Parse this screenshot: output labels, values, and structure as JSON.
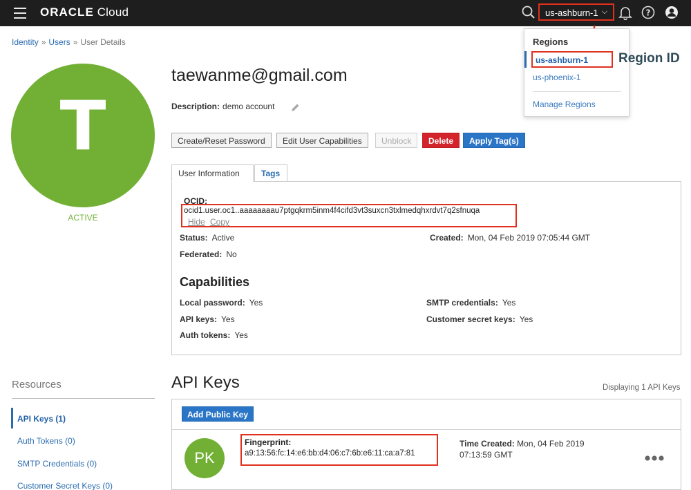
{
  "header": {
    "logo_brand": "ORACLE",
    "logo_product": " Cloud",
    "region_selected": "us-ashburn-1"
  },
  "region_menu": {
    "title": "Regions",
    "items": [
      "us-ashburn-1",
      "us-phoenix-1"
    ],
    "manage": "Manage Regions",
    "callout": "Region ID"
  },
  "breadcrumb": {
    "items": [
      "Identity",
      "Users",
      "User Details"
    ],
    "separator": "»"
  },
  "user": {
    "initial": "T",
    "state": "ACTIVE",
    "email": "taewanme@gmail.com",
    "description_label": "Description:",
    "description": "demo account"
  },
  "actions": {
    "create_reset_password": "Create/Reset Password",
    "edit_capabilities": "Edit User Capabilities",
    "unblock": "Unblock",
    "delete": "Delete",
    "apply_tags": "Apply Tag(s)"
  },
  "tabs": {
    "user_information": "User Information",
    "tags": "Tags"
  },
  "info": {
    "ocid_label": "OCID:",
    "ocid_value": "ocid1.user.oc1..aaaaaaaau7ptgqkrm5inm4f4cifd3vt3suxcn3txlmedqhxrdvt7q2sfnuqa",
    "hide": "Hide",
    "copy": "Copy",
    "status_label": "Status:",
    "status_value": "Active",
    "created_label": "Created:",
    "created_value": "Mon, 04 Feb 2019 07:05:44 GMT",
    "federated_label": "Federated:",
    "federated_value": "No"
  },
  "capabilities": {
    "title": "Capabilities",
    "local_password_label": "Local password:",
    "local_password": "Yes",
    "smtp_label": "SMTP credentials:",
    "smtp": "Yes",
    "api_keys_label": "API keys:",
    "api_keys": "Yes",
    "customer_secret_label": "Customer secret keys:",
    "customer_secret": "Yes",
    "auth_tokens_label": "Auth tokens:",
    "auth_tokens": "Yes"
  },
  "resources": {
    "title": "Resources",
    "items": [
      "API Keys (1)",
      "Auth Tokens (0)",
      "SMTP Credentials (0)",
      "Customer Secret Keys (0)"
    ]
  },
  "api_keys": {
    "title": "API Keys",
    "displaying": "Displaying 1 API Keys",
    "add_button": "Add Public Key",
    "key_initials": "PK",
    "fingerprint_label": "Fingerprint:",
    "fingerprint": "a9:13:56:fc:14:e6:bb:d4:06:c7:6b:e6:11:ca:a7:81",
    "time_created_label": "Time Created:",
    "time_created_line1": "Mon, 04 Feb 2019",
    "time_created_line2": "07:13:59 GMT"
  },
  "colors": {
    "accent_green": "#72b035",
    "link_blue": "#2b6cb0",
    "highlight_red": "#e0301e",
    "header_bg": "#1e1e1e"
  }
}
